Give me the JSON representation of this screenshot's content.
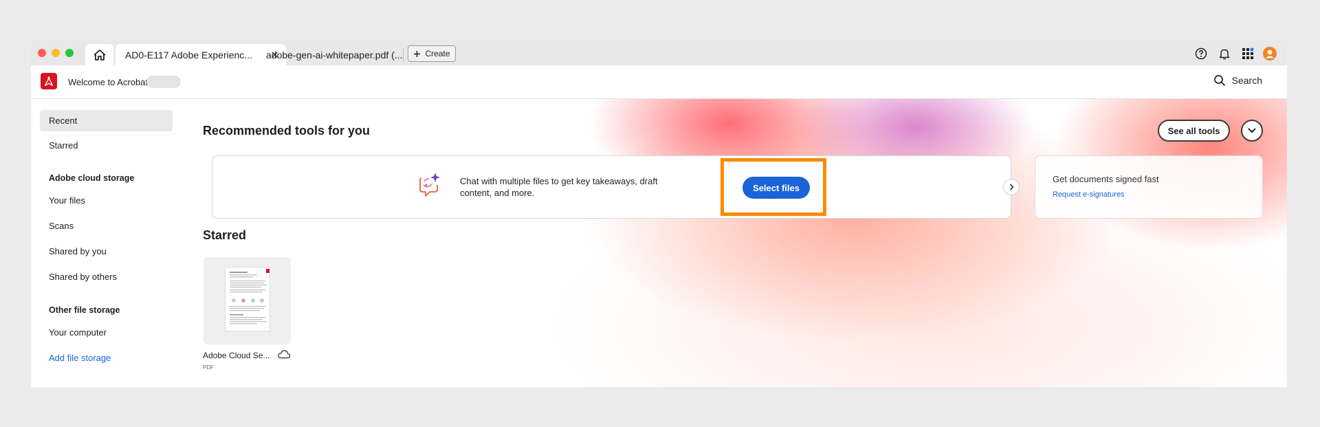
{
  "tabs": {
    "active": {
      "label": "AD0-E117 Adobe Experienc..."
    },
    "second": {
      "label": "adobe-gen-ai-whitepaper.pdf (..."
    },
    "create_label": "Create"
  },
  "header": {
    "welcome": "Welcome to Acrobat,",
    "search_label": "Search"
  },
  "sidebar": {
    "items": [
      {
        "label": "Recent"
      },
      {
        "label": "Starred"
      }
    ],
    "cloud_heading": "Adobe cloud storage",
    "cloud_items": [
      {
        "label": "Your files"
      },
      {
        "label": "Scans"
      },
      {
        "label": "Shared by you"
      },
      {
        "label": "Shared by others"
      }
    ],
    "other_heading": "Other file storage",
    "other_items": [
      {
        "label": "Your computer"
      },
      {
        "label": "Add file storage"
      }
    ]
  },
  "main": {
    "recommended_title": "Recommended tools for you",
    "see_all_label": "See all tools",
    "tool": {
      "text": "Chat with multiple files to get key takeaways, draft content, and more.",
      "button_label": "Select files"
    },
    "sign": {
      "title": "Get documents signed fast",
      "link": "Request e-signatures"
    },
    "starred_title": "Starred",
    "file": {
      "name": "Adobe Cloud Se...",
      "type": "PDF"
    }
  },
  "colors": {
    "accent": "#1a63d9",
    "highlight": "#ff8a00",
    "brand": "#d7151f"
  }
}
